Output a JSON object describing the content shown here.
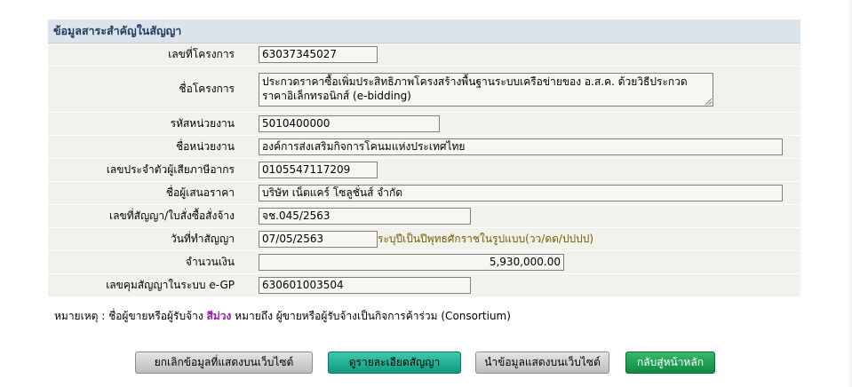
{
  "panel": {
    "title": "ข้อมูลสาระสำคัญในสัญญา"
  },
  "fields": {
    "project_no": {
      "label": "เลขที่โครงการ",
      "value": "63037345027"
    },
    "project_name": {
      "label": "ชื่อโครงการ",
      "value": "ประกวดราคาซื้อเพิ่มประสิทธิภาพโครงสร้างพื้นฐานระบบเครือข่ายของ อ.ส.ค. ด้วยวิธีประกวดราคาอิเล็กทรอนิกส์ (e-bidding)"
    },
    "agency_code": {
      "label": "รหัสหน่วยงาน",
      "value": "5010400000"
    },
    "agency_name": {
      "label": "ชื่อหน่วยงาน",
      "value": "องค์การส่งเสริมกิจการโคนมแห่งประเทศไทย"
    },
    "tax_id": {
      "label": "เลขประจำตัวผู้เสียภาษีอากร",
      "value": "0105547117209"
    },
    "bidder_name": {
      "label": "ชื่อผู้เสนอราคา",
      "value": "บริษัท เน็ตแคร์ โซลูชั่นส์ จำกัด"
    },
    "contract_no": {
      "label": "เลขที่สัญญา/ใบสั่งซื้อสั่งจ้าง",
      "value": "จช.045/2563"
    },
    "contract_date": {
      "label": "วันที่ทำสัญญา",
      "value": "07/05/2563",
      "hint": "ระบุปีเป็นปีพุทธศักราชในรูปแบบ(วว/ดด/ปปปป)"
    },
    "amount": {
      "label": "จำนวนเงิน",
      "value": "5,930,000.00"
    },
    "egp_control_no": {
      "label": "เลขคุมสัญญาในระบบ e-GP",
      "value": "630601003504"
    }
  },
  "note": {
    "prefix": "หมายเหตุ : ชื่อผู้ขายหรือผู้รับจ้าง",
    "highlight": "สีม่วง",
    "suffix": "หมายถึง ผู้ขายหรือผู้รับจ้างเป็นกิจการค้าร่วม (Consortium)"
  },
  "buttons": {
    "cancel_display": "ยกเลิกข้อมูลที่แสดงบนเว็บไซต์",
    "view_contract": "ดูรายละเอียดสัญญา",
    "publish": "นำข้อมูลแสดงบนเว็บไซต์",
    "back_home": "กลับสู่หน้าหลัก"
  },
  "colors": {
    "header_bg": "#dde3ea",
    "row_bg": "#f2f2ec",
    "consortium_purple": "#9a1fa8",
    "hint_color": "#7a5a00"
  }
}
